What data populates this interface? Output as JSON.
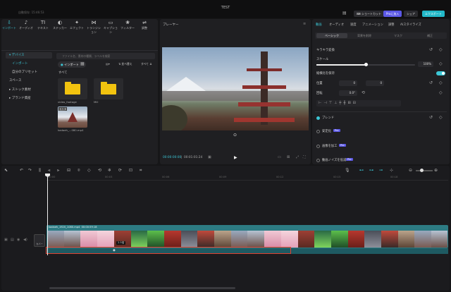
{
  "app": {
    "title": "TEST",
    "autosave": "自動保存: 15:46:53"
  },
  "topbar": {
    "shortcut": "ショートカット",
    "pro": "Proに加入",
    "share": "シェア",
    "export": "エクスポート"
  },
  "toolbar": [
    {
      "label": "インポート",
      "icon": "import-icon",
      "glyph": "⇩",
      "active": true
    },
    {
      "label": "オーディオ",
      "icon": "audio-icon",
      "glyph": "♪"
    },
    {
      "label": "テキスト",
      "icon": "text-icon",
      "glyph": "TI"
    },
    {
      "label": "ステッカー",
      "icon": "sticker-icon",
      "glyph": "◐"
    },
    {
      "label": "エフェクト",
      "icon": "effect-icon",
      "glyph": "✦"
    },
    {
      "label": "トランジション",
      "icon": "transition-icon",
      "glyph": "⋈"
    },
    {
      "label": "キャプション",
      "icon": "caption-icon",
      "glyph": "▭"
    },
    {
      "label": "フィルター",
      "icon": "filter-icon",
      "glyph": "❀"
    },
    {
      "label": "調整",
      "icon": "adjust-icon",
      "glyph": "⇌"
    }
  ],
  "sidebar": {
    "items": [
      {
        "label": "▾ デバイス",
        "active": true
      },
      {
        "label": "インポート",
        "active": true,
        "sub": true
      },
      {
        "label": "自分のプリセット",
        "sub": true
      },
      {
        "label": "スペース"
      },
      {
        "label": "▸ ストック素材"
      },
      {
        "label": "▸ ブランド資産"
      }
    ]
  },
  "media": {
    "search_placeholder": "ファイル名、素材の種類、ラベルを検索",
    "import_label": "インポート",
    "all_label": "すべて",
    "sort_label": "並べ替え",
    "filter_label": "すべて",
    "items": [
      {
        "name": "video_footage",
        "type": "folder"
      },
      {
        "name": "Mill",
        "type": "folder"
      },
      {
        "name": "kadaeh_...080.mp4",
        "type": "video",
        "badge": "追加済"
      }
    ]
  },
  "player": {
    "title": "プレーヤー",
    "time_current": "00:00:00:00",
    "time_total": "00:01:01:24"
  },
  "right": {
    "tabs": [
      "動画",
      "オーディオ",
      "速度",
      "アニメーション",
      "調整",
      "AIスタイライズ"
    ],
    "subtabs": [
      "ベーシック",
      "背景を削除",
      "マスク",
      "補正"
    ],
    "keyframe_label": "キラキラ変換",
    "scale_label": "スケール",
    "scale_value": "100%",
    "scale_fraction": 0.5,
    "ratio_label": "縦横比を保持",
    "position_label": "位置",
    "pos_x": "0",
    "pos_y": "0",
    "rotation_label": "回転",
    "rotation_value": "0.0°",
    "blend_label": "ブレンド",
    "stabilize_label": "安定化",
    "enhance_label": "画像を加工",
    "denoise_label": "動画ノイズを低減",
    "pro_badge": "Pro"
  },
  "timeline": {
    "ruler": [
      "00:00",
      "00:03",
      "00:06",
      "00:09",
      "00:12",
      "00:15",
      "00:18"
    ],
    "clip_label": "kadaeh_1920_1080.mp4",
    "clip_duration": "00:00:59:18",
    "cover_label": "カバー",
    "tooltip": "2.5倍"
  },
  "colors": {
    "accent": "#3cc7d6",
    "pro": "#5b58e6",
    "clip": "#2d7b83",
    "audio": "#1e5a62",
    "select": "#e0402f"
  }
}
